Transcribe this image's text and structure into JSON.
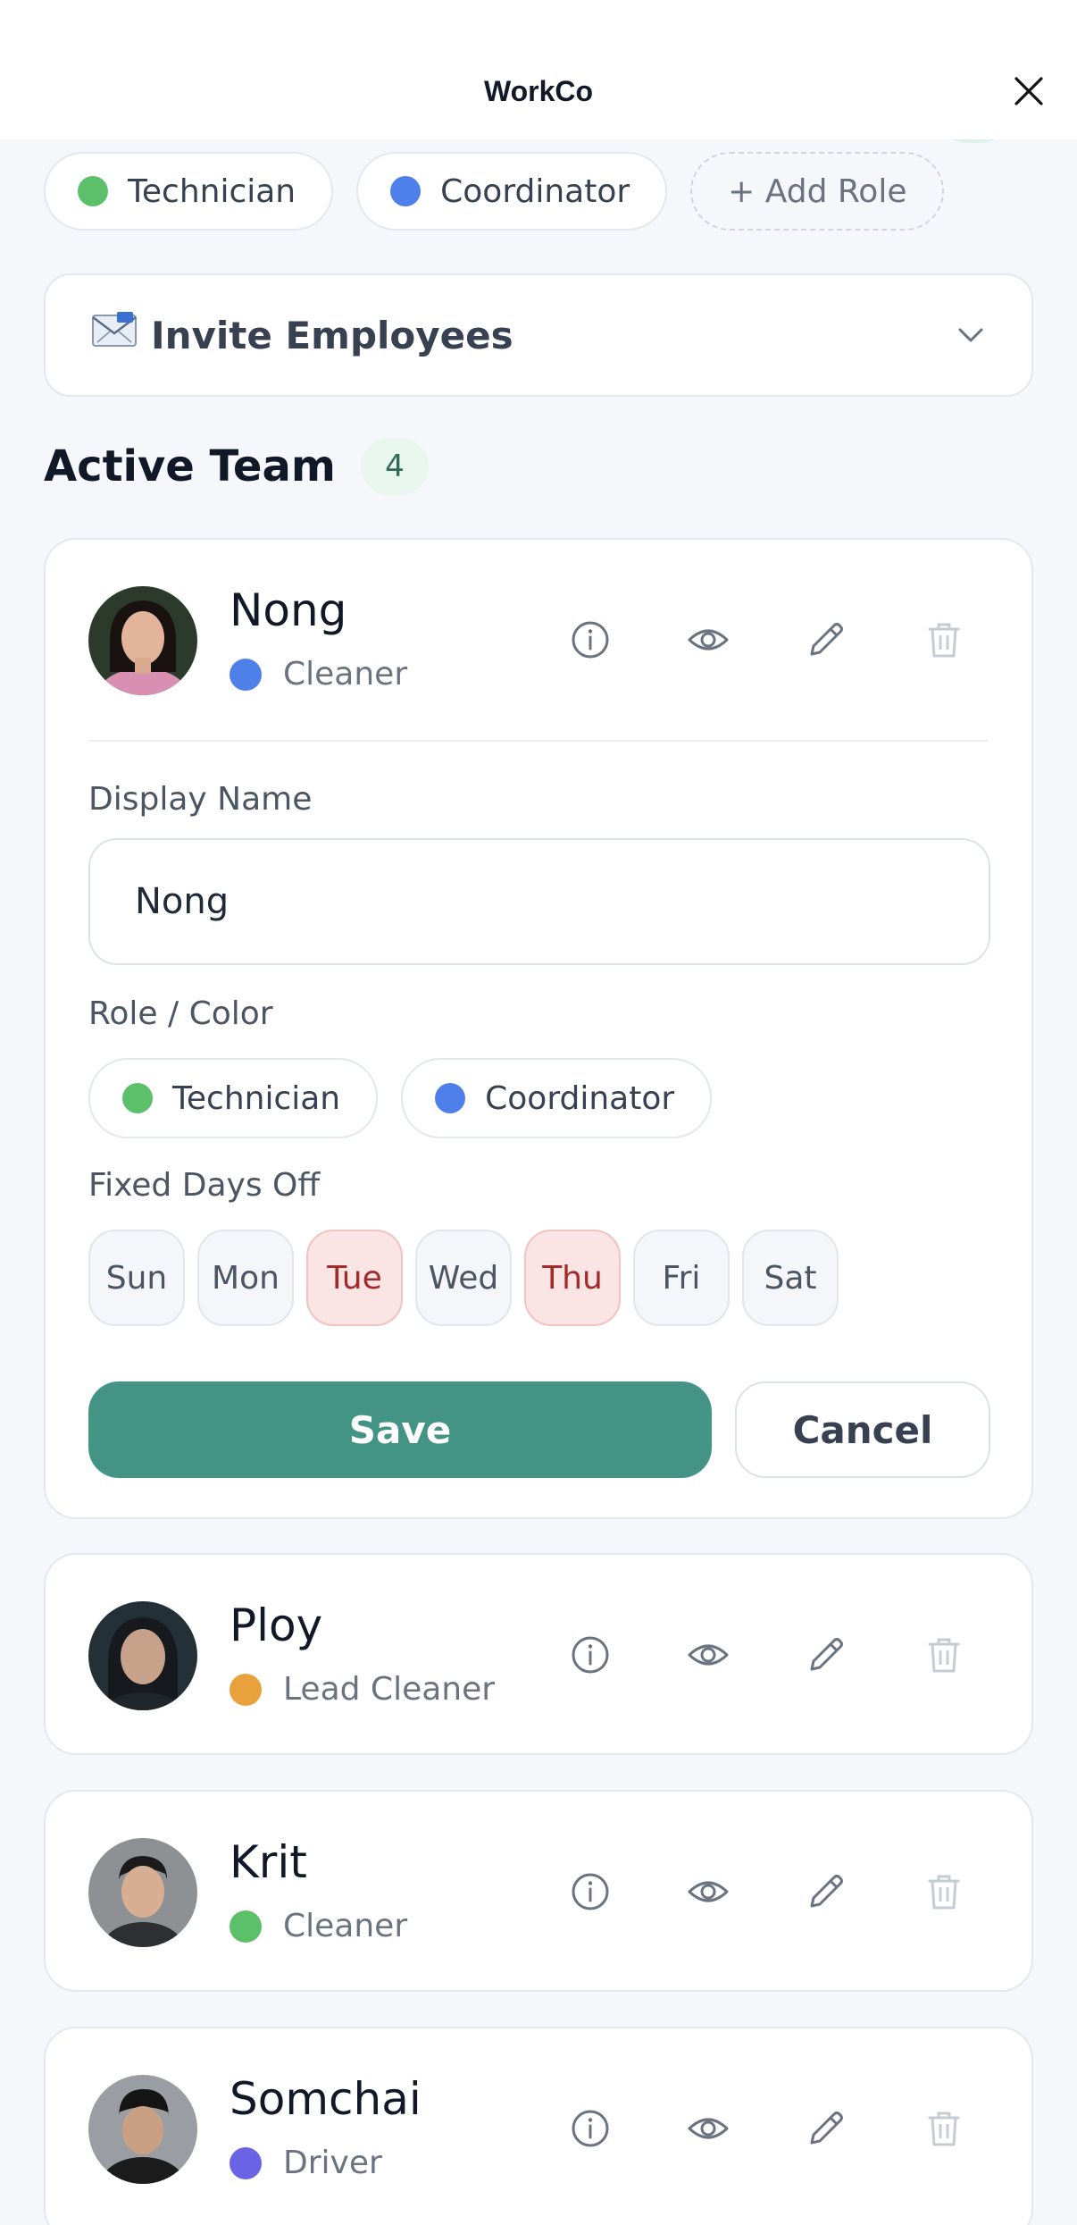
{
  "header": {
    "app_title": "WorkCo"
  },
  "roles": [
    {
      "label": "Technician",
      "color": "#5cc06b"
    },
    {
      "label": "Coordinator",
      "color": "#4f80ea"
    }
  ],
  "add_role_label": "+ Add Role",
  "invite": {
    "label": "Invite Employees",
    "icon": "envelope-icon"
  },
  "active_team": {
    "title": "Active Team",
    "count": "4"
  },
  "editor": {
    "display_name_label": "Display Name",
    "display_name_value": "Nong",
    "role_color_label": "Role / Color",
    "role_options": [
      {
        "label": "Technician",
        "color": "#5cc06b"
      },
      {
        "label": "Coordinator",
        "color": "#4f80ea"
      }
    ],
    "days_off_label": "Fixed Days Off",
    "days": [
      {
        "label": "Sun",
        "off": false
      },
      {
        "label": "Mon",
        "off": false
      },
      {
        "label": "Tue",
        "off": true
      },
      {
        "label": "Wed",
        "off": false
      },
      {
        "label": "Thu",
        "off": true
      },
      {
        "label": "Fri",
        "off": false
      },
      {
        "label": "Sat",
        "off": false
      }
    ],
    "save_label": "Save",
    "cancel_label": "Cancel"
  },
  "employees": [
    {
      "name": "Nong",
      "role": "Cleaner",
      "role_color": "#4f80ea"
    },
    {
      "name": "Ploy",
      "role": "Lead Cleaner",
      "role_color": "#e9a23b"
    },
    {
      "name": "Krit",
      "role": "Cleaner",
      "role_color": "#5cc06b"
    },
    {
      "name": "Somchai",
      "role": "Driver",
      "role_color": "#6b63e6"
    }
  ]
}
